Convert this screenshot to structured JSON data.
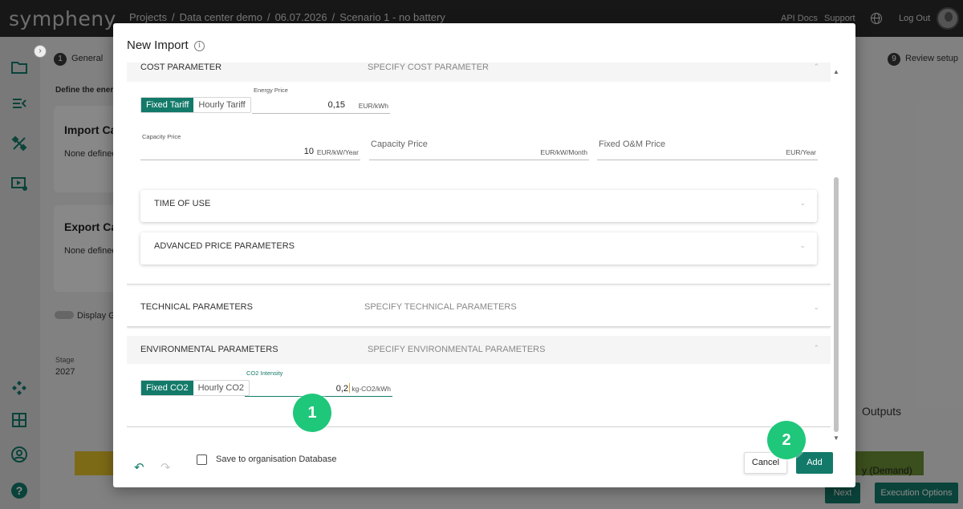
{
  "app": {
    "logo": "sympheny",
    "breadcrumbs": [
      "Projects",
      "Data center demo",
      "06.07.2026",
      "Scenario 1 - no battery"
    ],
    "breadcrumb_sep": "/",
    "api_docs": "API Docs",
    "support": "Support",
    "logout": "Log Out"
  },
  "background": {
    "step_1_num": "1",
    "step_1_label": "General",
    "step_9_num": "9",
    "step_9_label": "Review setup",
    "define_text": "Define the ener",
    "import_card_title": "Import Ca",
    "import_card_text": "None defined",
    "export_card_title": "Export Ca",
    "export_card_text": "None defined",
    "display_toggle_label": "Display G",
    "stage_label": "Stage",
    "stage_value": "2027",
    "outputs_label": "Outputs",
    "demand_label": "y (Demand)",
    "next_button": "Next",
    "execution_options_button": "Execution Options"
  },
  "modal": {
    "title": "New Import",
    "cost_section": {
      "label": "COST PARAMETER",
      "sub": "SPECIFY COST PARAMETER",
      "tariff_options": [
        "Fixed Tariff",
        "Hourly Tariff"
      ],
      "energy_price": {
        "label": "Energy Price",
        "value": "0,15",
        "unit": "EUR/kWh"
      },
      "capacity_price_filled": {
        "label": "Capacity Price",
        "value": "10",
        "unit": "EUR/kW/Year"
      },
      "capacity_price_empty": {
        "placeholder": "Capacity Price",
        "unit": "EUR/kW/Month"
      },
      "fixed_om_price": {
        "placeholder": "Fixed O&M Price",
        "unit": "EUR/Year"
      },
      "time_of_use": "TIME OF USE",
      "advanced_price": "ADVANCED PRICE PARAMETERS"
    },
    "technical_section": {
      "label": "TECHNICAL PARAMETERS",
      "sub": "SPECIFY TECHNICAL PARAMETERS"
    },
    "environmental_section": {
      "label": "ENVIRONMENTAL PARAMETERS",
      "sub": "SPECIFY ENVIRONMENTAL PARAMETERS",
      "co2_options": [
        "Fixed CO2",
        "Hourly CO2"
      ],
      "co2_intensity": {
        "label": "CO2 Intensity",
        "value": "0,2",
        "unit": "kg-CO2/kWh"
      }
    },
    "footer": {
      "save_to_db": "Save to organisation Database",
      "cancel": "Cancel",
      "add": "Add"
    }
  },
  "annotations": {
    "marker_1": "1",
    "marker_2": "2"
  },
  "colors": {
    "accent": "#137a6a",
    "marker": "#1fc77a",
    "topbar": "#2b2b2b"
  }
}
